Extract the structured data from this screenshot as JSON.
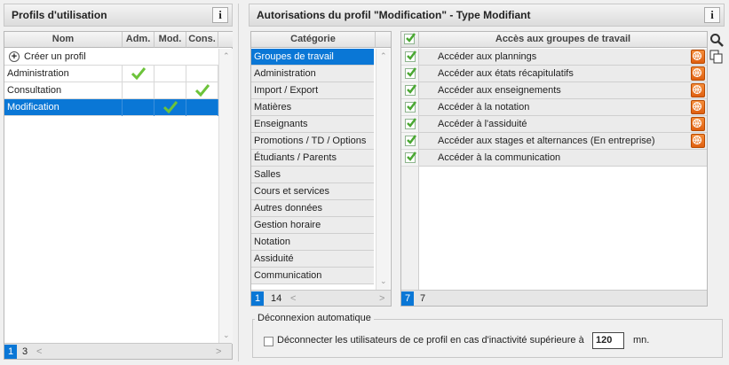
{
  "left_panel": {
    "title": "Profils d'utilisation",
    "info": "i",
    "columns": [
      "Nom",
      "Adm.",
      "Mod.",
      "Cons."
    ],
    "create_label": "Créer un profil",
    "rows": [
      {
        "name": "Administration",
        "adm": true,
        "mod": false,
        "cons": false
      },
      {
        "name": "Consultation",
        "adm": false,
        "mod": false,
        "cons": true
      },
      {
        "name": "Modification",
        "adm": false,
        "mod": true,
        "cons": false
      }
    ],
    "pager": {
      "current": "1",
      "total": "3",
      "prev": "<",
      "next": ">"
    }
  },
  "right_panel": {
    "title": "Autorisations du profil \"Modification\" - Type Modifiant",
    "info": "i",
    "category_header": "Catégorie",
    "categories": [
      "Groupes de travail",
      "Administration",
      "Import / Export",
      "Matières",
      "Enseignants",
      "Promotions / TD / Options",
      "Étudiants / Parents",
      "Salles",
      "Cours et services",
      "Autres données",
      "Gestion horaire",
      "Notation",
      "Assiduité",
      "Communication"
    ],
    "category_pager": {
      "current": "1",
      "total": "14",
      "prev": "<",
      "next": ">"
    },
    "permissions_header": "Accès aux groupes de travail",
    "permissions": [
      {
        "label": "Accéder aux plannings",
        "globe": true
      },
      {
        "label": "Accéder aux états récapitulatifs",
        "globe": true
      },
      {
        "label": "Accéder aux enseignements",
        "globe": true
      },
      {
        "label": "Accéder à la notation",
        "globe": true
      },
      {
        "label": "Accéder à l'assiduité",
        "globe": true
      },
      {
        "label": "Accéder aux stages et alternances (En entreprise)",
        "globe": true
      },
      {
        "label": "Accéder à la communication",
        "globe": false
      }
    ],
    "perm_pager": {
      "current": "7",
      "total": "7"
    },
    "auto_disconnect": {
      "legend": "Déconnexion automatique",
      "label": "Déconnecter les utilisateurs de ce profil en cas d'inactivité supérieure à",
      "value": "120",
      "unit": "mn."
    }
  },
  "colors": {
    "accent": "#0a77d6",
    "check": "#6cc33a",
    "globe": "#e06010"
  }
}
